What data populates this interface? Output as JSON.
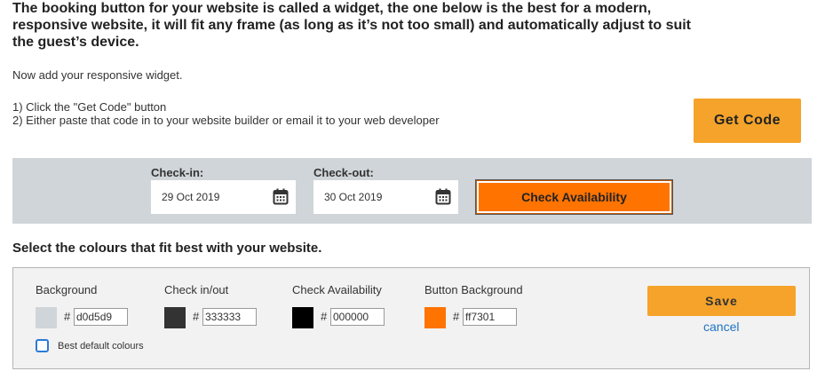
{
  "intro": {
    "heading": "The booking button for your website is called a widget, the one below is the best for a modern, responsive website, it will fit any frame (as long as it’s not too small) and automatically adjust to suit the guest’s device.",
    "add_widget_text": "Now add your responsive widget.",
    "step_1": "1) Click the \"Get Code\" button",
    "step_2": "2) Either paste that code in to your website builder or email it to your web developer",
    "get_code_label": "Get Code"
  },
  "widget": {
    "background_color": "#d0d5d9",
    "checkin_label": "Check-in:",
    "checkin_value": "29 Oct 2019",
    "checkout_label": "Check-out:",
    "checkout_value": "30 Oct 2019",
    "check_availability_label": "Check Availability",
    "button_color": "#ff7301",
    "calendar_icon": "calendar-icon"
  },
  "colours": {
    "heading": "Select the colours that fit best with your website.",
    "hash": "#",
    "fields": [
      {
        "label": "Background",
        "value": "d0d5d9",
        "swatch": "#d0d5d9"
      },
      {
        "label": "Check in/out",
        "value": "333333",
        "swatch": "#333333"
      },
      {
        "label": "Check Availability",
        "value": "000000",
        "swatch": "#000000"
      },
      {
        "label": "Button Background",
        "value": "ff7301",
        "swatch": "#ff7301"
      }
    ],
    "best_default_label": "Best default colours",
    "best_default_checked": false,
    "save_label": "Save",
    "cancel_label": "cancel"
  }
}
